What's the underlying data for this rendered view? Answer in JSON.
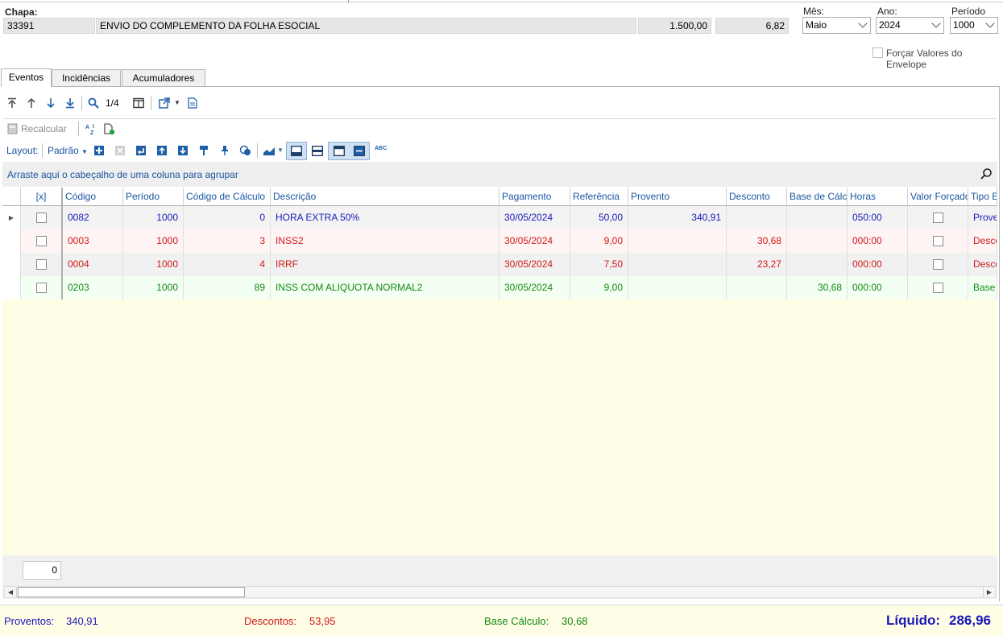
{
  "header": {
    "chapa_label": "Chapa:",
    "chapa_value": "33391",
    "description": "ENVIO DO COMPLEMENTO DA FOLHA ESOCIAL",
    "amount": "1.500,00",
    "rate": "6,82",
    "mes_label": "Mês:",
    "mes_value": "Maio",
    "ano_label": "Ano:",
    "ano_value": "2024",
    "periodo_label": "Período",
    "periodo_value": "1000",
    "forcar_label": "Forçar Valores do Envelope"
  },
  "tabs": [
    {
      "label": "Eventos",
      "active": true
    },
    {
      "label": "Incidências",
      "active": false
    },
    {
      "label": "Acumuladores",
      "active": false
    }
  ],
  "toolbar": {
    "record_counter": "1/4",
    "recalcular_label": "Recalcular",
    "layout_label": "Layout:",
    "padrao_label": "Padrão",
    "abc_label": "ABC"
  },
  "grid": {
    "group_hint": "Arraste aqui o cabeçalho de uma coluna para agrupar",
    "columns": [
      "[x]",
      "Código",
      "Período",
      "Código de Cálculo",
      "Descrição",
      "Pagamento",
      "Referência",
      "Provento",
      "Desconto",
      "Base de Cálc...",
      "Horas",
      "Valor Forçado",
      "Tipo E"
    ],
    "rows": [
      {
        "codigo": "0082",
        "periodo": "1000",
        "cod_calc": "0",
        "descricao": "HORA EXTRA 50%",
        "pagamento": "30/05/2024",
        "referencia": "50,00",
        "provento": "340,91",
        "desconto": "",
        "base": "",
        "horas": "050:00",
        "tipo": "Provento",
        "color": "#1a1ab8",
        "bg": "#f3f3f3",
        "selected": true
      },
      {
        "codigo": "0003",
        "periodo": "1000",
        "cod_calc": "3",
        "descricao": "INSS2",
        "pagamento": "30/05/2024",
        "referencia": "9,00",
        "provento": "",
        "desconto": "30,68",
        "base": "",
        "horas": "000:00",
        "tipo": "Desconto",
        "color": "#d01818",
        "bg": "#fff4f4",
        "selected": false
      },
      {
        "codigo": "0004",
        "periodo": "1000",
        "cod_calc": "4",
        "descricao": "IRRF",
        "pagamento": "30/05/2024",
        "referencia": "7,50",
        "provento": "",
        "desconto": "23,27",
        "base": "",
        "horas": "000:00",
        "tipo": "Desconto",
        "color": "#d01818",
        "bg": "#f1f1f1",
        "selected": false
      },
      {
        "codigo": "0203",
        "periodo": "1000",
        "cod_calc": "89",
        "descricao": "INSS COM ALIQUOTA NORMAL2",
        "pagamento": "30/05/2024",
        "referencia": "9,00",
        "provento": "",
        "desconto": "",
        "base": "30,68",
        "horas": "000:00",
        "tipo": "Base",
        "color": "#138a13",
        "bg": "#f4fff4",
        "selected": false
      }
    ],
    "footer_count": "0"
  },
  "totals": {
    "proventos_label": "Proventos:",
    "proventos_value": "340,91",
    "descontos_label": "Descontos:",
    "descontos_value": "53,95",
    "base_label": "Base Cálculo:",
    "base_value": "30,68",
    "liquido_label": "Líquido:",
    "liquido_value": "286,96"
  },
  "colors": {
    "provento": "#1a1ab8",
    "desconto": "#d01818",
    "base": "#138a13",
    "accent": "#1a56a0",
    "empty_area": "#fffde6"
  }
}
